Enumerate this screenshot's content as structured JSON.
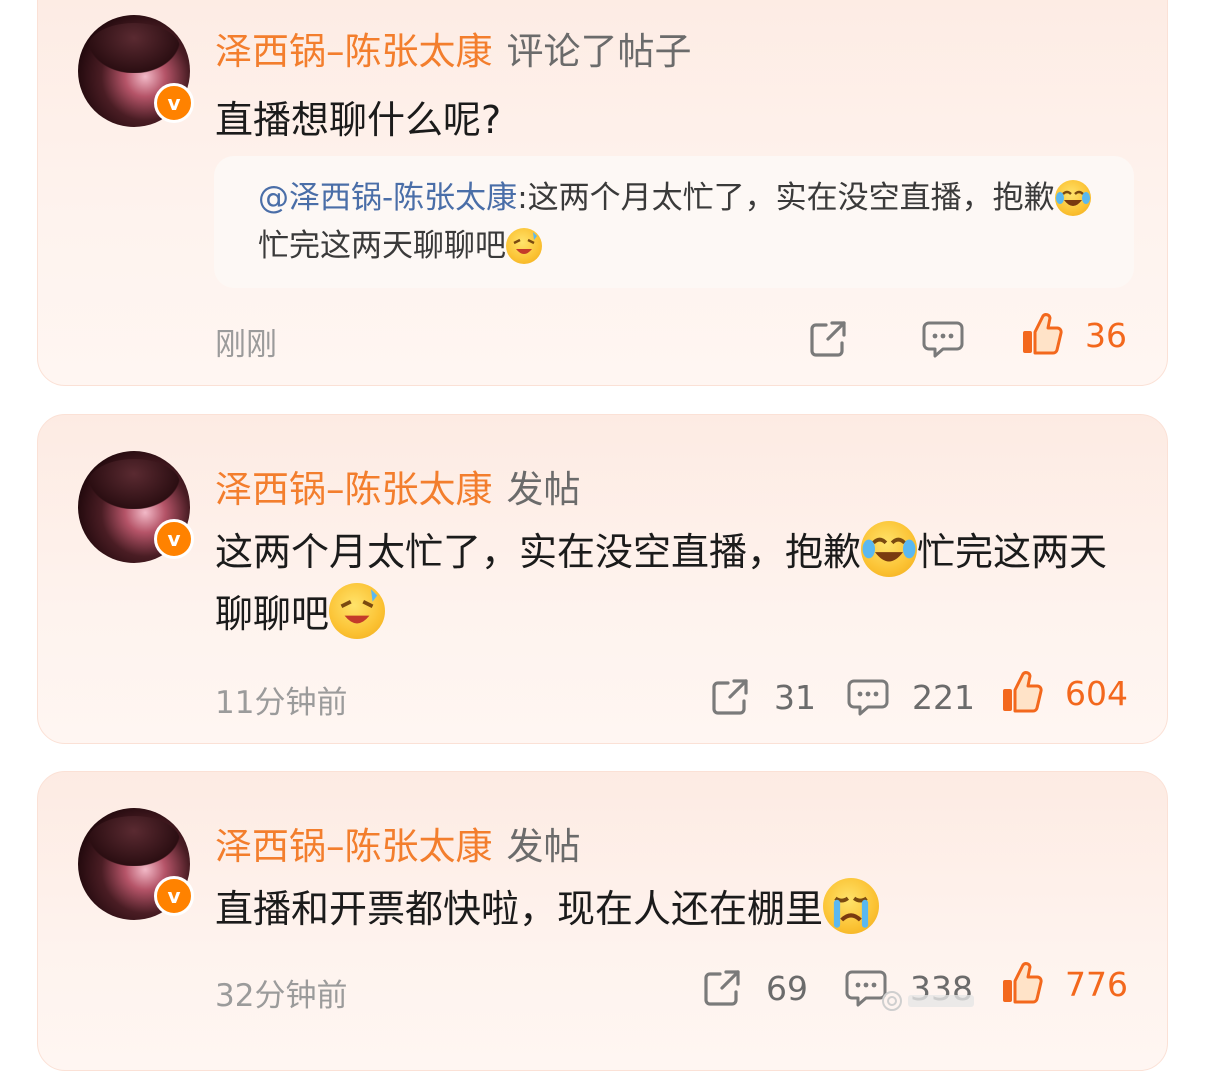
{
  "posts": [
    {
      "author": "泽西锅–陈张太康",
      "action": "评论了帖子",
      "text": "直播想聊什么呢?",
      "quote_at": "@泽西锅-陈张太康",
      "quote_text": ":这两个月太忙了，实在没空直播，抱歉",
      "quote_text2": "忙完这两天聊聊吧",
      "time": "刚刚",
      "likes": "36"
    },
    {
      "author": "泽西锅–陈张太康",
      "action": "发帖",
      "text": "这两个月太忙了，实在没空直播，抱歉",
      "text2": "忙完这两天聊聊吧",
      "time": "11分钟前",
      "shares": "31",
      "comments": "221",
      "likes": "604"
    },
    {
      "author": "泽西锅–陈张太康",
      "action": "发帖",
      "text": "直播和开票都快啦，现在人还在棚里",
      "time": "32分钟前",
      "shares": "69",
      "comments": "338",
      "likes": "776"
    }
  ],
  "colors": {
    "name": "#f37e2d",
    "like": "#f3681d",
    "badge": "#ff8200"
  },
  "icons": [
    "verified-badge-icon",
    "share-icon",
    "comment-icon",
    "thumbs-up-icon",
    "laugh-cry-emoji",
    "excited-emoji",
    "crying-emoji"
  ]
}
